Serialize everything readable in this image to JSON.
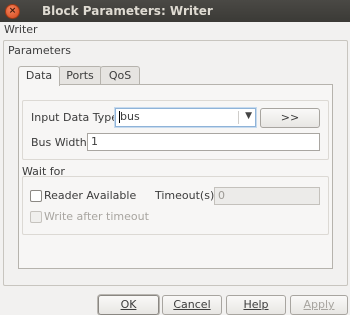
{
  "window": {
    "title": "Block Parameters: Writer",
    "close_glyph": "×",
    "minimize_glyph": "–",
    "maximize_glyph": "□"
  },
  "block_name": "Writer",
  "parameters_label": "Parameters",
  "tabs": [
    {
      "label": "Data",
      "active": true
    },
    {
      "label": "Ports",
      "active": false
    },
    {
      "label": "QoS",
      "active": false
    }
  ],
  "data_section": {
    "input_data_type_label": "Input Data Type:",
    "input_data_type_value": "bus",
    "type_assistant_button": ">>",
    "bus_width_label": "Bus Width:",
    "bus_width_value": "1"
  },
  "wait_for": {
    "label": "Wait for",
    "reader_available_label": "Reader Available",
    "reader_available_checked": false,
    "timeout_label": "Timeout(s):",
    "timeout_value": "0",
    "write_after_timeout_label": "Write after timeout",
    "write_after_timeout_checked": false
  },
  "buttons": {
    "ok": "OK",
    "cancel": "Cancel",
    "help": "Help",
    "apply": "Apply"
  },
  "colors": {
    "titlebar": "#3c3b37",
    "close_button": "#e9632c",
    "dialog_bg": "#f2f1f0",
    "focus_border": "#8fb3d8"
  }
}
